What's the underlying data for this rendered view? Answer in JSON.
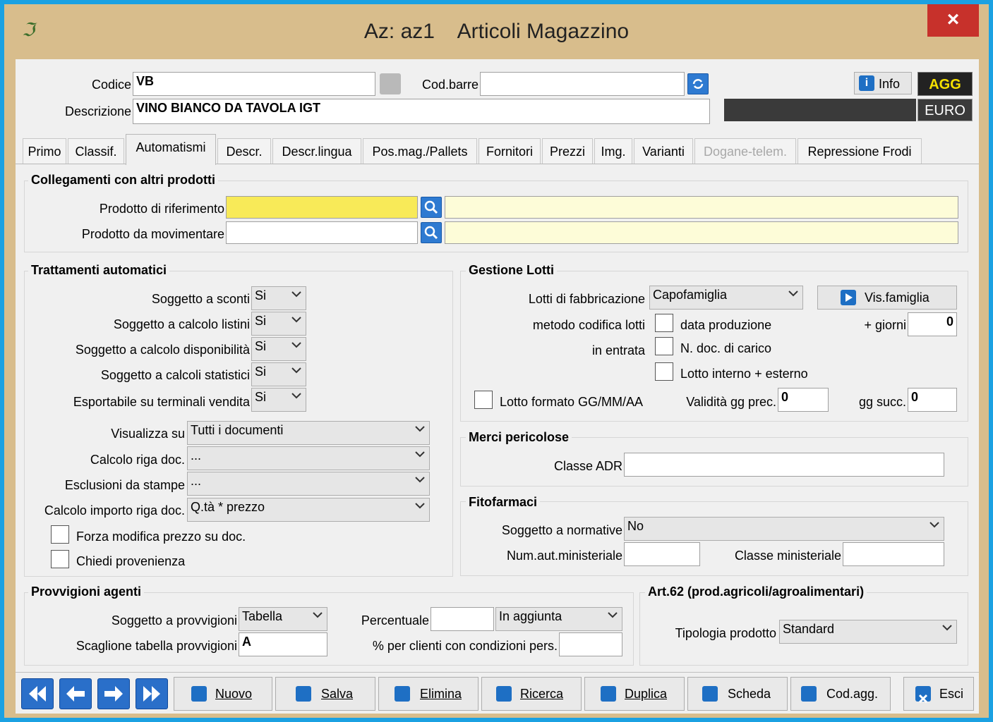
{
  "window": {
    "title": "Az: az1    Articoli Magazzino",
    "close_label": "×",
    "app_icon": "ℑ"
  },
  "header": {
    "codice_label": "Codice",
    "codice_value": "VB",
    "descrizione_label": "Descrizione",
    "descrizione_value": "VINO BIANCO DA TAVOLA IGT",
    "codbarre_label": "Cod.barre",
    "codbarre_value": "",
    "info_label": "Info",
    "agg_label": "AGG",
    "euro_label": "EURO"
  },
  "tabs": [
    {
      "label": "Primo"
    },
    {
      "label": "Classif."
    },
    {
      "label": "Automatismi"
    },
    {
      "label": "Descr."
    },
    {
      "label": "Descr.lingua"
    },
    {
      "label": "Pos.mag./Pallets"
    },
    {
      "label": "Fornitori"
    },
    {
      "label": "Prezzi"
    },
    {
      "label": "Img."
    },
    {
      "label": "Varianti"
    },
    {
      "label": "Dogane-telem."
    },
    {
      "label": "Repressione Frodi"
    }
  ],
  "collegamenti": {
    "title": "Collegamenti con altri prodotti",
    "rif_label": "Prodotto di riferimento",
    "rif_value": "",
    "mov_label": "Prodotto da movimentare",
    "mov_value": ""
  },
  "trattamenti": {
    "title": "Trattamenti automatici",
    "rows": [
      {
        "label": "Soggetto a sconti",
        "value": "Si"
      },
      {
        "label": "Soggetto a calcolo listini",
        "value": "Si"
      },
      {
        "label": "Soggetto a calcolo disponibilità",
        "value": "Si"
      },
      {
        "label": "Soggetto a calcoli statistici",
        "value": "Si"
      },
      {
        "label": "Esportabile su terminali vendita",
        "value": "Si"
      }
    ],
    "visualizza_label": "Visualizza su",
    "visualizza_value": "Tutti i documenti",
    "calcolo_riga_label": "Calcolo riga doc.",
    "calcolo_riga_value": "...",
    "esclusioni_label": "Esclusioni da stampe",
    "esclusioni_value": "...",
    "calcolo_importo_label": "Calcolo importo riga doc.",
    "calcolo_importo_value": "Q.tà * prezzo",
    "forza_label": "Forza modifica prezzo su doc.",
    "chiedi_label": "Chiedi provenienza"
  },
  "lotti": {
    "title": "Gestione Lotti",
    "fabbricazione_label": "Lotti di fabbricazione",
    "fabbricazione_value": "Capofamiglia",
    "vis_famiglia_label": "Vis.famiglia",
    "metodo_label": "metodo codifica lotti",
    "in_entrata_label": "in entrata",
    "data_produzione_label": "data produzione",
    "giorni_label": "+ giorni",
    "giorni_value": "0",
    "ndoc_label": "N. doc. di carico",
    "lotto_interno_label": "Lotto interno + esterno",
    "formato_label": "Lotto formato GG/MM/AA",
    "validita_label": "Validità gg prec.",
    "validita_value": "0",
    "ggsucc_label": "gg succ.",
    "ggsucc_value": "0"
  },
  "merci": {
    "title": "Merci pericolose",
    "adr_label": "Classe ADR",
    "adr_value": ""
  },
  "fitofarmaci": {
    "title": "Fitofarmaci",
    "normative_label": "Soggetto a normative",
    "normative_value": "No",
    "numaut_label": "Num.aut.ministeriale",
    "numaut_value": "",
    "classe_label": "Classe ministeriale",
    "classe_value": ""
  },
  "provvigioni": {
    "title": "Provvigioni agenti",
    "soggetto_label": "Soggetto a provvigioni",
    "soggetto_value": "Tabella",
    "scaglione_label": "Scaglione tabella provvigioni",
    "scaglione_value": "A",
    "percentuale_label": "Percentuale",
    "percentuale_value": "",
    "aggiunta_value": "In aggiunta",
    "perclienti_label": "% per clienti con condizioni pers.",
    "perclienti_value": ""
  },
  "art62": {
    "title": "Art.62 (prod.agricoli/agroalimentari)",
    "tipologia_label": "Tipologia prodotto",
    "tipologia_value": "Standard"
  },
  "toolbar": {
    "nuovo": "Nuovo",
    "salva": "Salva",
    "elimina": "Elimina",
    "ricerca": "Ricerca",
    "duplica": "Duplica",
    "scheda": "Scheda",
    "codagg": "Cod.agg.",
    "esci": "Esci"
  },
  "colors": {
    "title_bar": "#d8bd8c",
    "close": "#c7312b",
    "highlight_yellow": "#f8ea58",
    "agg_text": "#f5e000",
    "accent_blue": "#1e6fc4"
  }
}
